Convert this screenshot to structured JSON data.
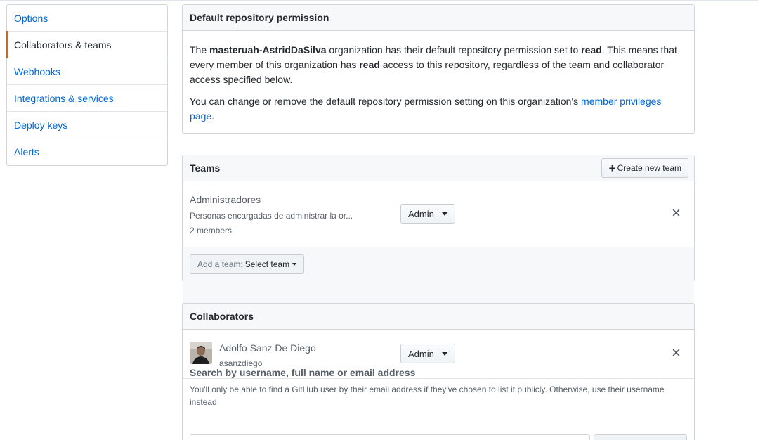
{
  "sidebar": {
    "items": [
      {
        "label": "Options"
      },
      {
        "label": "Collaborators & teams"
      },
      {
        "label": "Webhooks"
      },
      {
        "label": "Integrations & services"
      },
      {
        "label": "Deploy keys"
      },
      {
        "label": "Alerts"
      }
    ]
  },
  "default_permission": {
    "title": "Default repository permission",
    "p1_before": "The ",
    "org_name": "masteruah-AstridDaSilva",
    "p1_mid": " organization has their default repository permission set to ",
    "permission": "read",
    "p1_mid2": ". This means that every member of this organization has ",
    "permission2": "read",
    "p1_after": " access to this repository, regardless of the team and collaborator access specified below.",
    "p2_before": "You can change or remove the default repository permission setting on this organization's ",
    "p2_link": "member privileges page",
    "p2_after": "."
  },
  "teams": {
    "title": "Teams",
    "create_label": "Create new team",
    "rows": [
      {
        "name": "Administradores",
        "description": "Personas encargadas de administrar la or...",
        "members": "2 members",
        "role": "Admin"
      }
    ],
    "add_team_prefix": "Add a team:",
    "add_team_select": "Select team"
  },
  "collaborators": {
    "title": "Collaborators",
    "rows": [
      {
        "name": "Adolfo Sanz De Diego",
        "login": "asanzdiego",
        "role": "Admin"
      }
    ],
    "search_title": "Search by username, full name or email address",
    "search_note": "You'll only be able to find a GitHub user by their email address if they've chosen to list it publicly. Otherwise, use their username instead."
  },
  "icons": {
    "plus": "plus-icon",
    "close": "close-icon",
    "caret": "caret-down-icon"
  },
  "colors": {
    "link": "#0366d6",
    "selected_accent": "#e36209",
    "header_bg": "#f6f8fa"
  }
}
